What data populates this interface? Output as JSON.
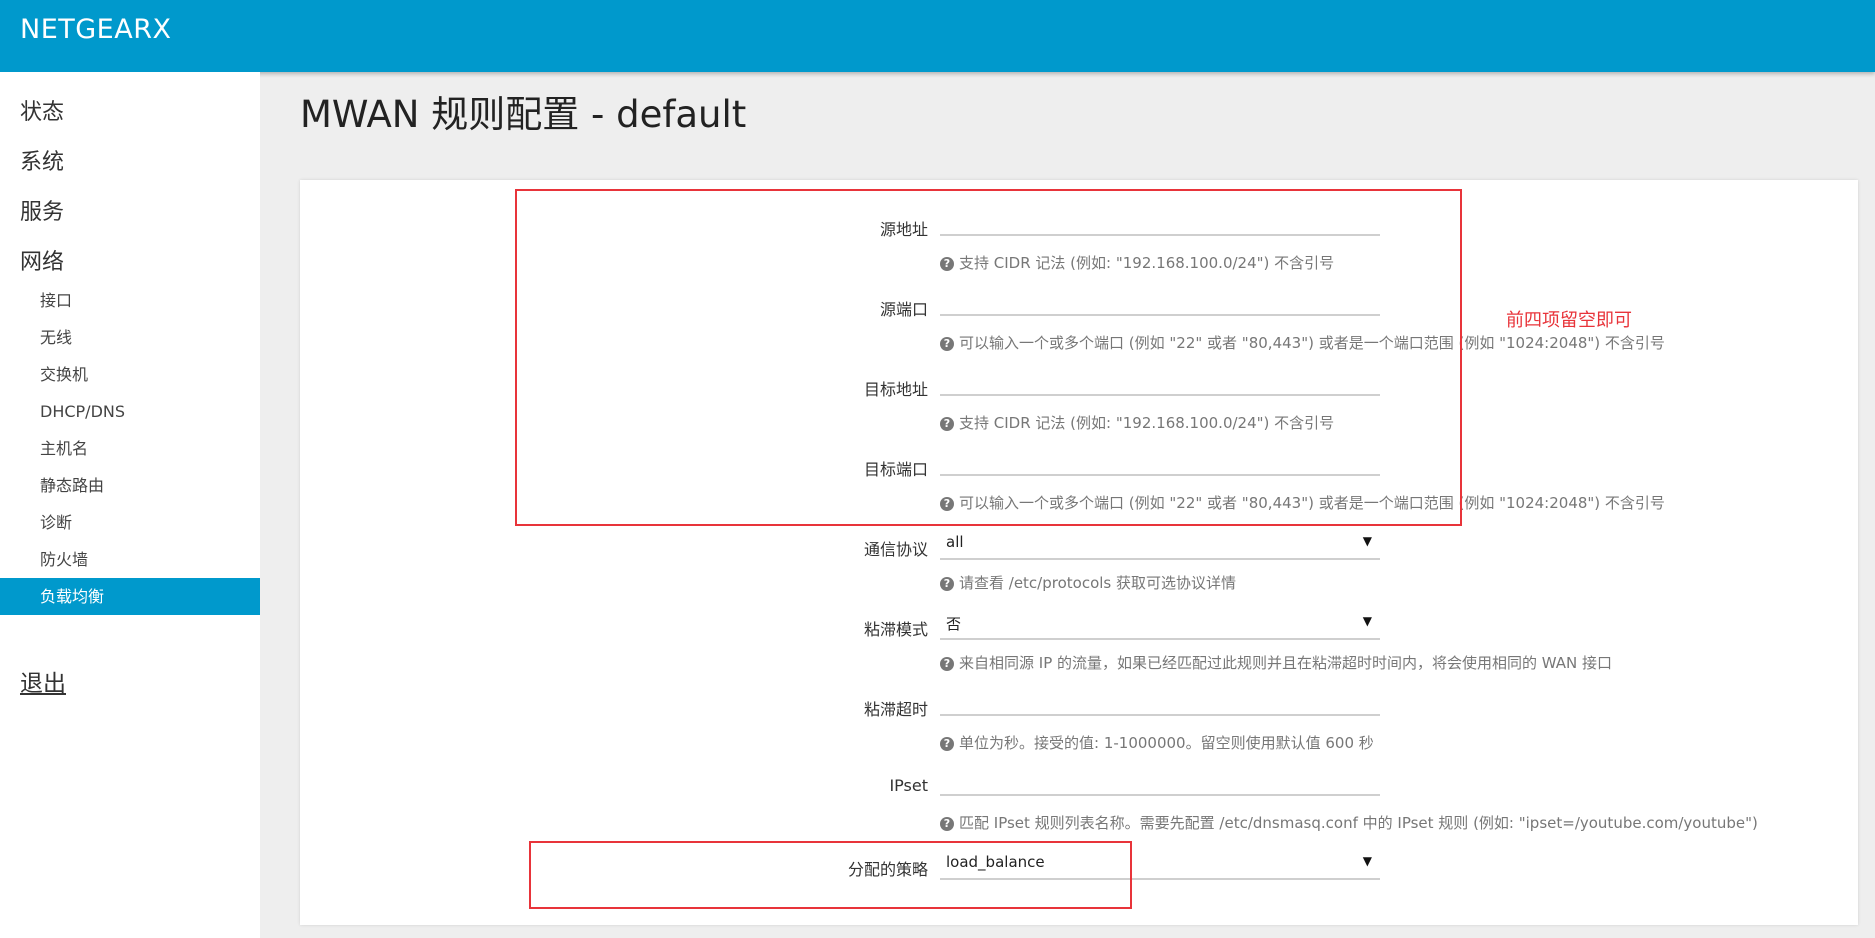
{
  "header": {
    "brand": "NETGEARX"
  },
  "sidebar": {
    "top_menus": [
      "状态",
      "系统",
      "服务",
      "网络"
    ],
    "sub_items": [
      {
        "label": "接口"
      },
      {
        "label": "无线"
      },
      {
        "label": "交换机"
      },
      {
        "label": "DHCP/DNS"
      },
      {
        "label": "主机名"
      },
      {
        "label": "静态路由"
      },
      {
        "label": "诊断"
      },
      {
        "label": "防火墙"
      },
      {
        "label": "负载均衡",
        "active": true
      }
    ],
    "logout": "退出"
  },
  "page": {
    "title": "MWAN 规则配置 - default"
  },
  "form": {
    "src_ip": {
      "label": "源地址",
      "value": "",
      "help": "支持 CIDR 记法 (例如: \"192.168.100.0/24\") 不含引号"
    },
    "src_port": {
      "label": "源端口",
      "value": "",
      "help": "可以输入一个或多个端口 (例如 \"22\" 或者 \"80,443\") 或者是一个端口范围 (例如 \"1024:2048\") 不含引号"
    },
    "dest_ip": {
      "label": "目标地址",
      "value": "",
      "help": "支持 CIDR 记法 (例如: \"192.168.100.0/24\") 不含引号"
    },
    "dest_port": {
      "label": "目标端口",
      "value": "",
      "help": "可以输入一个或多个端口 (例如 \"22\" 或者 \"80,443\") 或者是一个端口范围 (例如 \"1024:2048\") 不含引号"
    },
    "proto": {
      "label": "通信协议",
      "value": "all",
      "help": "请查看 /etc/protocols 获取可选协议详情"
    },
    "sticky": {
      "label": "粘滞模式",
      "value": "否",
      "help": "来自相同源 IP 的流量，如果已经匹配过此规则并且在粘滞超时时间内，将会使用相同的 WAN 接口"
    },
    "timeout": {
      "label": "粘滞超时",
      "value": "",
      "help": "单位为秒。接受的值: 1-1000000。留空则使用默认值 600 秒"
    },
    "ipset": {
      "label": "IPset",
      "value": "",
      "help": "匹配 IPset 规则列表名称。需要先配置 /etc/dnsmasq.conf 中的 IPset 规则 (例如: \"ipset=/youtube.com/youtube\")"
    },
    "policy": {
      "label": "分配的策略",
      "value": "load_balance"
    }
  },
  "annotation": {
    "text": "前四项留空即可",
    "color": "#e8343a"
  },
  "colors": {
    "accent": "#0099cc",
    "highlight": "#e8343a"
  },
  "icons": {
    "help": "question-circle-icon",
    "dropdown": "caret-down-icon"
  }
}
